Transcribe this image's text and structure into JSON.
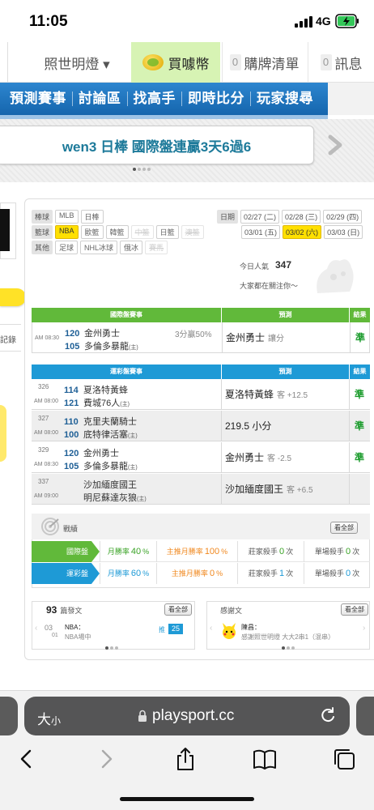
{
  "status": {
    "time": "11:05",
    "network": "4G"
  },
  "nav": {
    "site_name": "照世明燈 ▾",
    "buy_label": "買噱幣",
    "cart_count": "0",
    "cart_label": "購牌清單",
    "msg_count": "0",
    "msg_label": "訊息"
  },
  "menu": [
    "預測賽事",
    "討論區",
    "找高手",
    "即時比分",
    "玩家搜尋"
  ],
  "banner": {
    "text": "wen3 日棒 國際盤連贏3天6過6"
  },
  "left": {
    "record_label": "記錄"
  },
  "filters": {
    "baseball_label": "棒球",
    "baseball": [
      "MLB",
      "日棒"
    ],
    "basketball_label": "籃球",
    "basketball": [
      "NBA",
      "歐籃",
      "韓籃",
      "中籃",
      "日籃",
      "澳籃"
    ],
    "other_label": "其他",
    "other": [
      "足球",
      "NHL冰球",
      "俄冰",
      "賽馬"
    ]
  },
  "dates": {
    "label": "日期",
    "row1": [
      "02/27 (二)",
      "02/28 (三)",
      "02/29 (四)"
    ],
    "row2": [
      "03/01 (五)",
      "03/02 (六)",
      "03/03 (日)"
    ]
  },
  "popularity": {
    "label": "今日人氣",
    "value": "347",
    "sub": "大家都在關注你～"
  },
  "intl_table": {
    "head_game": "國際盤賽事",
    "head_pick": "預測",
    "head_result": "結果",
    "rows": [
      {
        "time": "AM 08:30",
        "away_num": "120",
        "away": "金州勇士",
        "home_num": "105",
        "home": "多倫多暴龍",
        "home_tag": "(主)",
        "note": "3分贏50%",
        "pick": "金州勇士",
        "pick_sub": "讓分",
        "result": "準"
      }
    ]
  },
  "lottery_table": {
    "head_game": "運彩盤賽事",
    "head_pick": "預測",
    "head_result": "結果",
    "rows": [
      {
        "id": "326",
        "time": "AM 08:00",
        "away_num": "114",
        "away": "夏洛特黃蜂",
        "home_num": "121",
        "home": "費城76人",
        "home_tag": "(主)",
        "pick": "夏洛特黃蜂",
        "pick_sub": "客 +12.5",
        "result": "準"
      },
      {
        "id": "327",
        "time": "AM 08:00",
        "away_num": "110",
        "away": "克里夫蘭騎士",
        "home_num": "100",
        "home": "底特律活塞",
        "home_tag": "(主)",
        "pick": "219.5 小分",
        "pick_sub": "",
        "result": "準"
      },
      {
        "id": "329",
        "time": "AM 08:30",
        "away_num": "120",
        "away": "金州勇士",
        "home_num": "105",
        "home": "多倫多暴龍",
        "home_tag": "(主)",
        "pick": "金州勇士",
        "pick_sub": "客 -2.5",
        "result": "準"
      },
      {
        "id": "337",
        "time": "AM 09:00",
        "away_num": "",
        "away": "沙加緬度國王",
        "home_num": "",
        "home": "明尼蘇達灰狼",
        "home_tag": "(主)",
        "pick": "沙加緬度國王",
        "pick_sub": "客 +6.5",
        "result": ""
      }
    ]
  },
  "record": {
    "title": "戰績",
    "see_all": "看全部",
    "rows": [
      {
        "label": "國際盤",
        "c1_pre": "月勝率",
        "c1_val": "40",
        "c1_post": "%",
        "c2_pre": "主推月勝率",
        "c2_val": "100",
        "c2_post": "%",
        "c3_pre": "莊家殺手",
        "c3_val": "0",
        "c3_post": "次",
        "c4_pre": "單場殺手",
        "c4_val": "0",
        "c4_post": "次"
      },
      {
        "label": "運彩盤",
        "c1_pre": "月勝率",
        "c1_val": "60",
        "c1_post": "%",
        "c2_pre": "主推月勝率",
        "c2_val": "0",
        "c2_post": "%",
        "c3_pre": "莊家殺手",
        "c3_val": "1",
        "c3_post": "次",
        "c4_pre": "單場殺手",
        "c4_val": "0",
        "c4_post": "次"
      }
    ]
  },
  "posts": {
    "count": "93",
    "title": "篇發文",
    "see_all": "看全部",
    "date_top": "03",
    "date_bottom": "01",
    "item_title": "NBA：",
    "item_sub": "NBA場中",
    "push_label": "推",
    "push_count": "25"
  },
  "thanks": {
    "title": "感謝文",
    "see_all": "看全部",
    "user": "陳昌：",
    "text": "感謝照世明燈 大大2串1（混串）"
  },
  "safari": {
    "text_size": "大",
    "text_size_small": "小",
    "url": "playsport.cc"
  },
  "colors": {
    "menu_blue": "#1565ad",
    "green": "#61b93a",
    "blue": "#1e9ad6",
    "orange": "#f0881f",
    "win": "#1a9b2b"
  }
}
